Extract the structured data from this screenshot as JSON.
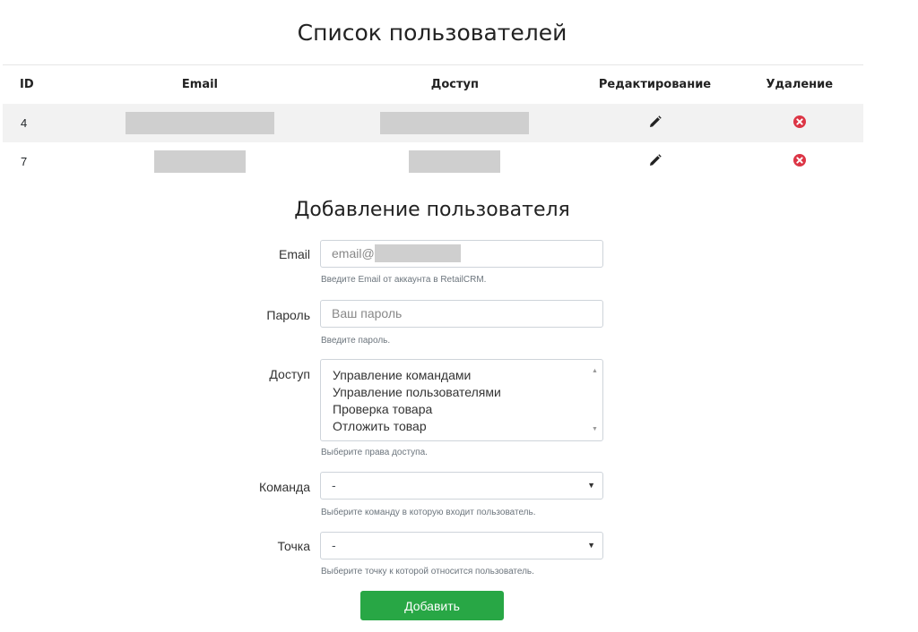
{
  "page": {
    "title": "Список пользователей"
  },
  "table": {
    "headers": {
      "id": "ID",
      "email": "Email",
      "access": "Доступ",
      "edit": "Редактирование",
      "delete": "Удаление"
    },
    "rows": [
      {
        "id": "4",
        "email": "",
        "access": ""
      },
      {
        "id": "7",
        "email": "",
        "access": ""
      }
    ]
  },
  "form": {
    "title": "Добавление пользователя",
    "email": {
      "label": "Email",
      "placeholder": "email@",
      "help": "Введите Email от аккаунта в RetailCRM."
    },
    "password": {
      "label": "Пароль",
      "placeholder": "Ваш пароль",
      "help": "Введите пароль."
    },
    "access": {
      "label": "Доступ",
      "options": [
        "Управление командами",
        "Управление пользователями",
        "Проверка товара",
        "Отложить товар"
      ],
      "help": "Выберите права доступа."
    },
    "team": {
      "label": "Команда",
      "value": "-",
      "help": "Выберите команду в которую входит пользователь."
    },
    "point": {
      "label": "Точка",
      "value": "-",
      "help": "Выберите точку к которой относится пользователь."
    },
    "submit_label": "Добавить"
  },
  "colors": {
    "accent": "#28a745",
    "delete": "#dc3545",
    "stripe": "#f2f2f2"
  },
  "icons": {
    "edit": "pencil-icon",
    "delete": "times-circle-icon"
  }
}
